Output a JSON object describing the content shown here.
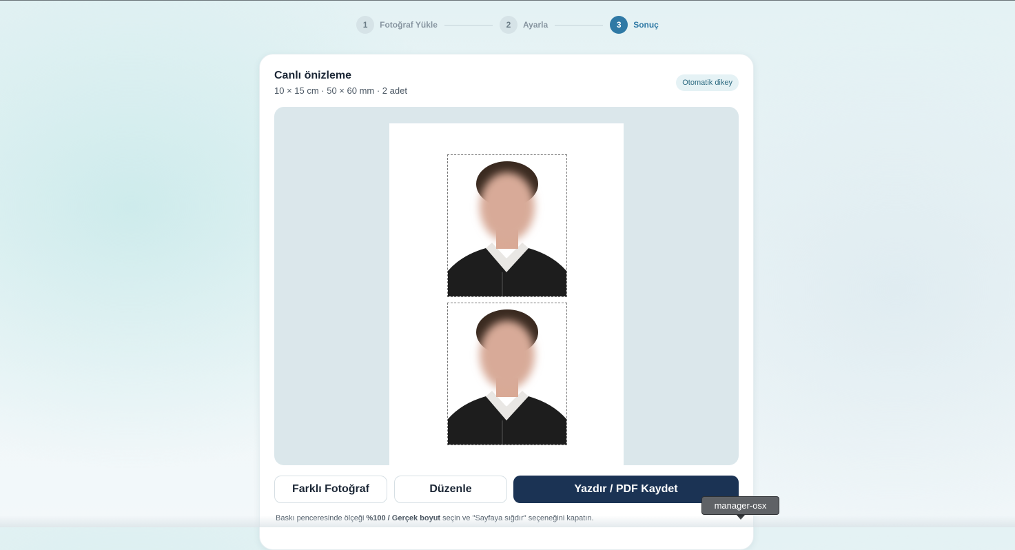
{
  "stepper": {
    "steps": [
      {
        "number": "1",
        "label": "Fotoğraf Yükle"
      },
      {
        "number": "2",
        "label": "Ayarla"
      },
      {
        "number": "3",
        "label": "Sonuç"
      }
    ],
    "active_step": 3
  },
  "preview": {
    "title": "Canlı önizleme",
    "subtitle": "10 × 15 cm · 50 × 60 mm · 2 adet",
    "badge": "Otomatik dikey",
    "photo_count": 2
  },
  "actions": {
    "different_photo": "Farklı Fotoğraf",
    "edit": "Düzenle",
    "print": "Yazdır / PDF Kaydet"
  },
  "hint": {
    "prefix": "Baskı penceresinde ölçeği ",
    "bold": "%100 / Gerçek boyut",
    "suffix": " seçin ve \"Sayfaya sığdır\" seçeneğini kapatın."
  },
  "tooltip": {
    "text": "manager-osx"
  },
  "colors": {
    "accent": "#2f79a5",
    "primary_button": "#1b3354",
    "preview_background": "#dbe7eb"
  }
}
